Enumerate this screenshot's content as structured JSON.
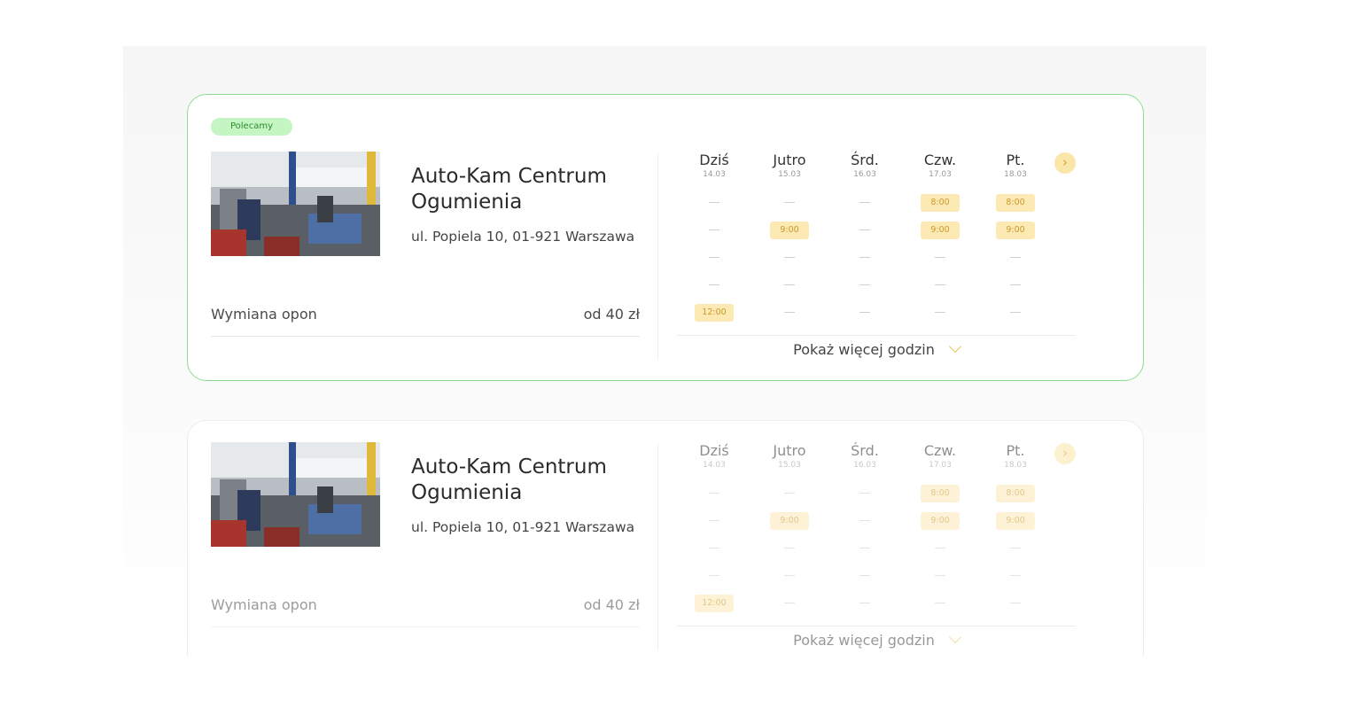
{
  "colors": {
    "featured_border": "#8fdd8c",
    "badge_bg": "#c6f5c4",
    "slot_bg": "#fde9b3",
    "slot_text": "#c99a2d",
    "accent_icon": "#ecc35a"
  },
  "cards": [
    {
      "badge": "Polecamy",
      "name": "Auto-Kam Centrum Ogumienia",
      "address": "ul. Popiela 10, 01-921 Warszawa",
      "service": "Wymiana opon",
      "price": "od 40 zł",
      "next_icon": "chevron-right-icon",
      "more_label": "Pokaż więcej godzin",
      "more_icon": "chevron-down-icon",
      "days": [
        {
          "name": "Dziś",
          "date": "14.03",
          "slots": [
            "",
            "",
            "",
            "",
            "12:00"
          ]
        },
        {
          "name": "Jutro",
          "date": "15.03",
          "slots": [
            "",
            "9:00",
            "",
            "",
            ""
          ]
        },
        {
          "name": "Śrd.",
          "date": "16.03",
          "slots": [
            "",
            "",
            "",
            "",
            ""
          ]
        },
        {
          "name": "Czw.",
          "date": "17.03",
          "slots": [
            "8:00",
            "9:00",
            "",
            "",
            ""
          ]
        },
        {
          "name": "Pt.",
          "date": "18.03",
          "slots": [
            "8:00",
            "9:00",
            "",
            "",
            ""
          ]
        }
      ]
    },
    {
      "badge": "",
      "name": "Auto-Kam Centrum Ogumienia",
      "address": "ul. Popiela 10, 01-921 Warszawa",
      "service": "Wymiana opon",
      "price": "od 40 zł",
      "next_icon": "chevron-right-icon",
      "more_label": "Pokaż więcej godzin",
      "more_icon": "chevron-down-icon",
      "days": [
        {
          "name": "Dziś",
          "date": "14.03",
          "slots": [
            "",
            "",
            "",
            "",
            "12:00"
          ]
        },
        {
          "name": "Jutro",
          "date": "15.03",
          "slots": [
            "",
            "9:00",
            "",
            "",
            ""
          ]
        },
        {
          "name": "Śrd.",
          "date": "16.03",
          "slots": [
            "",
            "",
            "",
            "",
            ""
          ]
        },
        {
          "name": "Czw.",
          "date": "17.03",
          "slots": [
            "8:00",
            "9:00",
            "",
            "",
            ""
          ]
        },
        {
          "name": "Pt.",
          "date": "18.03",
          "slots": [
            "8:00",
            "9:00",
            "",
            "",
            ""
          ]
        }
      ]
    }
  ]
}
